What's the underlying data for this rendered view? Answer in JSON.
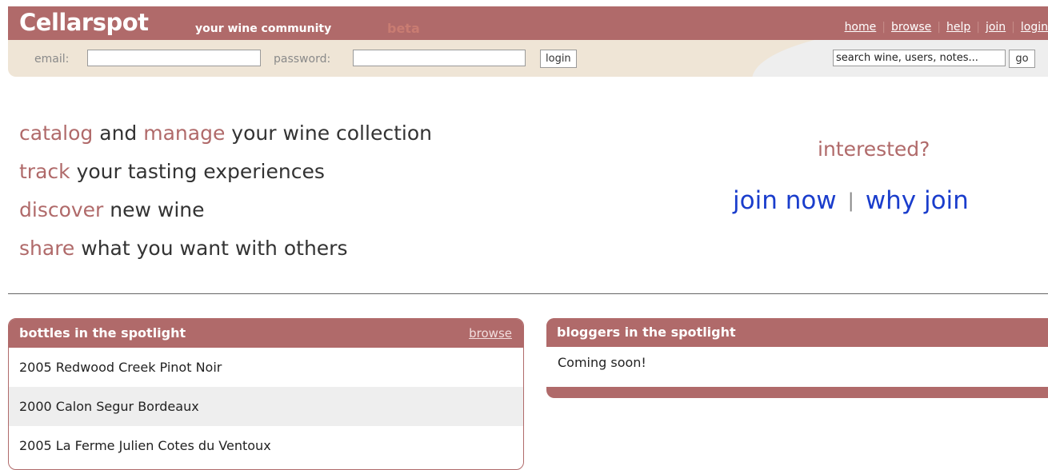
{
  "header": {
    "logo": "Cellarspot",
    "tagline": "your wine community",
    "beta": "beta",
    "nav": [
      "home",
      "browse",
      "help",
      "join",
      "login"
    ]
  },
  "login_bar": {
    "email_label": "email:",
    "email_value": "",
    "password_label": "password:",
    "password_value": "",
    "login_button": "login",
    "search_value": "search wine, users, notes...",
    "go_button": "go"
  },
  "hero": {
    "lines": [
      {
        "highlight": "catalog",
        "mid": " and ",
        "highlight2": "manage",
        "rest": " your wine collection"
      },
      {
        "highlight": "track",
        "rest": " your tasting experiences"
      },
      {
        "highlight": "discover",
        "rest": " new wine"
      },
      {
        "highlight": "share",
        "rest": " what you want with others"
      }
    ],
    "interested": "interested?",
    "join_now": "join now",
    "separator": "|",
    "why_join": "why join"
  },
  "bottles": {
    "title": "bottles in the spotlight",
    "browse": "browse",
    "items": [
      "2005 Redwood Creek Pinot Noir",
      "2000 Calon Segur Bordeaux",
      "2005 La Ferme Julien Cotes du Ventoux"
    ]
  },
  "bloggers": {
    "title": "bloggers in the spotlight",
    "body": "Coming soon!"
  },
  "colors": {
    "brand": "#b06a6a",
    "strip": "#efe5d6",
    "link": "#1a3dcc"
  }
}
